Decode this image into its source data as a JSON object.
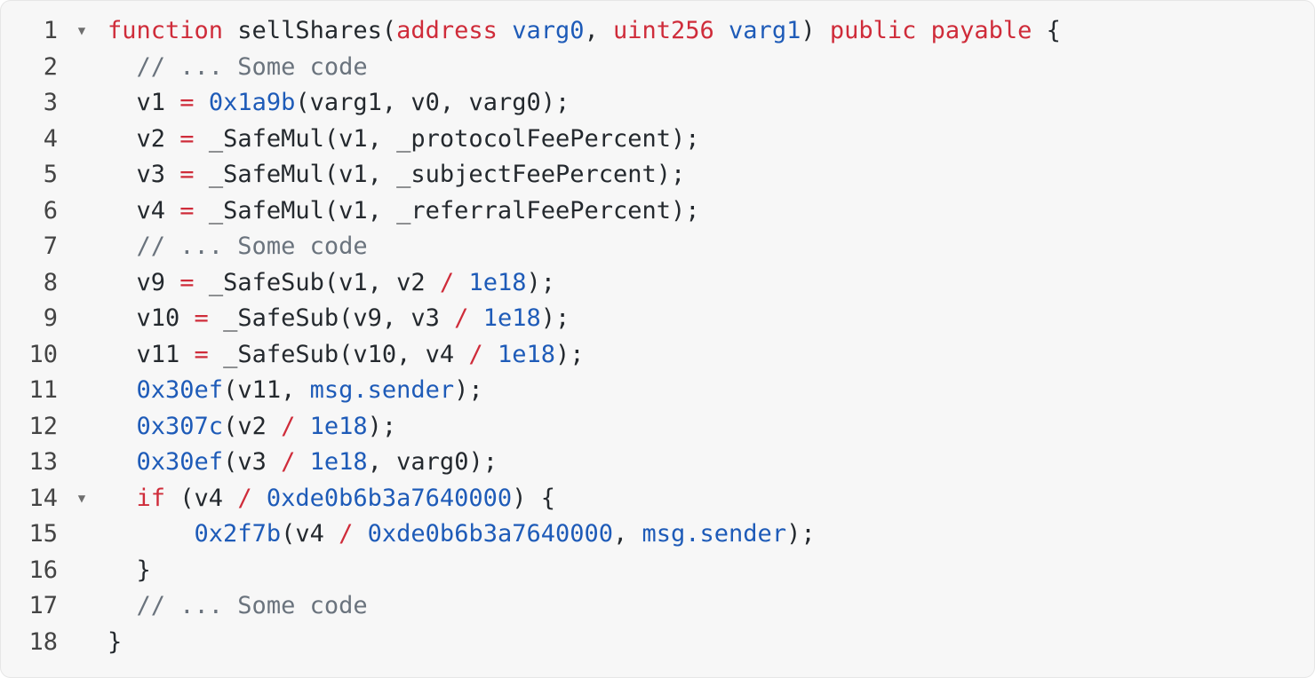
{
  "editor": {
    "fold_icon": "triangle-down-icon",
    "colors": {
      "background": "#f7f7f7",
      "keyword": "#cf2c3a",
      "number": "#1e5bb8",
      "comment": "#6a737d",
      "plain": "#24292e",
      "line_number": "#444444"
    },
    "lines": [
      {
        "number": "1",
        "foldable": true,
        "tokens": [
          {
            "t": "keyword",
            "v": "function"
          },
          {
            "t": "plain",
            "v": " sellShares("
          },
          {
            "t": "keyword",
            "v": "address"
          },
          {
            "t": "plain",
            "v": " "
          },
          {
            "t": "number",
            "v": "varg0"
          },
          {
            "t": "plain",
            "v": ", "
          },
          {
            "t": "keyword",
            "v": "uint256"
          },
          {
            "t": "plain",
            "v": " "
          },
          {
            "t": "number",
            "v": "varg1"
          },
          {
            "t": "plain",
            "v": ") "
          },
          {
            "t": "keyword",
            "v": "public payable"
          },
          {
            "t": "plain",
            "v": " {"
          }
        ]
      },
      {
        "number": "2",
        "foldable": false,
        "tokens": [
          {
            "t": "indent",
            "v": "  "
          },
          {
            "t": "comment",
            "v": "// ... Some code"
          }
        ]
      },
      {
        "number": "3",
        "foldable": false,
        "tokens": [
          {
            "t": "indent",
            "v": "  "
          },
          {
            "t": "plain",
            "v": "v1 "
          },
          {
            "t": "operator",
            "v": "="
          },
          {
            "t": "plain",
            "v": " "
          },
          {
            "t": "number",
            "v": "0x1a9b"
          },
          {
            "t": "plain",
            "v": "(varg1, v0, varg0);"
          }
        ]
      },
      {
        "number": "4",
        "foldable": false,
        "tokens": [
          {
            "t": "indent",
            "v": "  "
          },
          {
            "t": "plain",
            "v": "v2 "
          },
          {
            "t": "operator",
            "v": "="
          },
          {
            "t": "plain",
            "v": " _SafeMul(v1, _protocolFeePercent);"
          }
        ]
      },
      {
        "number": "5",
        "foldable": false,
        "tokens": [
          {
            "t": "indent",
            "v": "  "
          },
          {
            "t": "plain",
            "v": "v3 "
          },
          {
            "t": "operator",
            "v": "="
          },
          {
            "t": "plain",
            "v": " _SafeMul(v1, _subjectFeePercent);"
          }
        ]
      },
      {
        "number": "6",
        "foldable": false,
        "tokens": [
          {
            "t": "indent",
            "v": "  "
          },
          {
            "t": "plain",
            "v": "v4 "
          },
          {
            "t": "operator",
            "v": "="
          },
          {
            "t": "plain",
            "v": " _SafeMul(v1, _referralFeePercent);"
          }
        ]
      },
      {
        "number": "7",
        "foldable": false,
        "tokens": [
          {
            "t": "indent",
            "v": "  "
          },
          {
            "t": "comment",
            "v": "// ... Some code"
          }
        ]
      },
      {
        "number": "8",
        "foldable": false,
        "tokens": [
          {
            "t": "indent",
            "v": "  "
          },
          {
            "t": "plain",
            "v": "v9 "
          },
          {
            "t": "operator",
            "v": "="
          },
          {
            "t": "plain",
            "v": " _SafeSub(v1, v2 "
          },
          {
            "t": "operator",
            "v": "/"
          },
          {
            "t": "plain",
            "v": " "
          },
          {
            "t": "number",
            "v": "1e18"
          },
          {
            "t": "plain",
            "v": ");"
          }
        ]
      },
      {
        "number": "9",
        "foldable": false,
        "tokens": [
          {
            "t": "indent",
            "v": "  "
          },
          {
            "t": "plain",
            "v": "v10 "
          },
          {
            "t": "operator",
            "v": "="
          },
          {
            "t": "plain",
            "v": " _SafeSub(v9, v3 "
          },
          {
            "t": "operator",
            "v": "/"
          },
          {
            "t": "plain",
            "v": " "
          },
          {
            "t": "number",
            "v": "1e18"
          },
          {
            "t": "plain",
            "v": ");"
          }
        ]
      },
      {
        "number": "10",
        "foldable": false,
        "tokens": [
          {
            "t": "indent",
            "v": "  "
          },
          {
            "t": "plain",
            "v": "v11 "
          },
          {
            "t": "operator",
            "v": "="
          },
          {
            "t": "plain",
            "v": " _SafeSub(v10, v4 "
          },
          {
            "t": "operator",
            "v": "/"
          },
          {
            "t": "plain",
            "v": " "
          },
          {
            "t": "number",
            "v": "1e18"
          },
          {
            "t": "plain",
            "v": ");"
          }
        ]
      },
      {
        "number": "11",
        "foldable": false,
        "tokens": [
          {
            "t": "indent",
            "v": "  "
          },
          {
            "t": "number",
            "v": "0x30ef"
          },
          {
            "t": "plain",
            "v": "(v11, "
          },
          {
            "t": "builtin",
            "v": "msg.sender"
          },
          {
            "t": "plain",
            "v": ");"
          }
        ]
      },
      {
        "number": "12",
        "foldable": false,
        "tokens": [
          {
            "t": "indent",
            "v": "  "
          },
          {
            "t": "number",
            "v": "0x307c"
          },
          {
            "t": "plain",
            "v": "(v2 "
          },
          {
            "t": "operator",
            "v": "/"
          },
          {
            "t": "plain",
            "v": " "
          },
          {
            "t": "number",
            "v": "1e18"
          },
          {
            "t": "plain",
            "v": ");"
          }
        ]
      },
      {
        "number": "13",
        "foldable": false,
        "tokens": [
          {
            "t": "indent",
            "v": "  "
          },
          {
            "t": "number",
            "v": "0x30ef"
          },
          {
            "t": "plain",
            "v": "(v3 "
          },
          {
            "t": "operator",
            "v": "/"
          },
          {
            "t": "plain",
            "v": " "
          },
          {
            "t": "number",
            "v": "1e18"
          },
          {
            "t": "plain",
            "v": ", varg0);"
          }
        ]
      },
      {
        "number": "14",
        "foldable": true,
        "tokens": [
          {
            "t": "indent",
            "v": "  "
          },
          {
            "t": "keyword",
            "v": "if"
          },
          {
            "t": "plain",
            "v": " (v4 "
          },
          {
            "t": "operator",
            "v": "/"
          },
          {
            "t": "plain",
            "v": " "
          },
          {
            "t": "number",
            "v": "0xde0b6b3a7640000"
          },
          {
            "t": "plain",
            "v": ") {"
          }
        ]
      },
      {
        "number": "15",
        "foldable": false,
        "tokens": [
          {
            "t": "indent",
            "v": "      "
          },
          {
            "t": "number",
            "v": "0x2f7b"
          },
          {
            "t": "plain",
            "v": "(v4 "
          },
          {
            "t": "operator",
            "v": "/"
          },
          {
            "t": "plain",
            "v": " "
          },
          {
            "t": "number",
            "v": "0xde0b6b3a7640000"
          },
          {
            "t": "plain",
            "v": ", "
          },
          {
            "t": "builtin",
            "v": "msg.sender"
          },
          {
            "t": "plain",
            "v": ");"
          }
        ]
      },
      {
        "number": "16",
        "foldable": false,
        "tokens": [
          {
            "t": "indent",
            "v": "  "
          },
          {
            "t": "plain",
            "v": "}"
          }
        ]
      },
      {
        "number": "17",
        "foldable": false,
        "tokens": [
          {
            "t": "indent",
            "v": "  "
          },
          {
            "t": "comment",
            "v": "// ... Some code"
          }
        ]
      },
      {
        "number": "18",
        "foldable": false,
        "tokens": [
          {
            "t": "plain",
            "v": "}"
          }
        ]
      }
    ]
  }
}
